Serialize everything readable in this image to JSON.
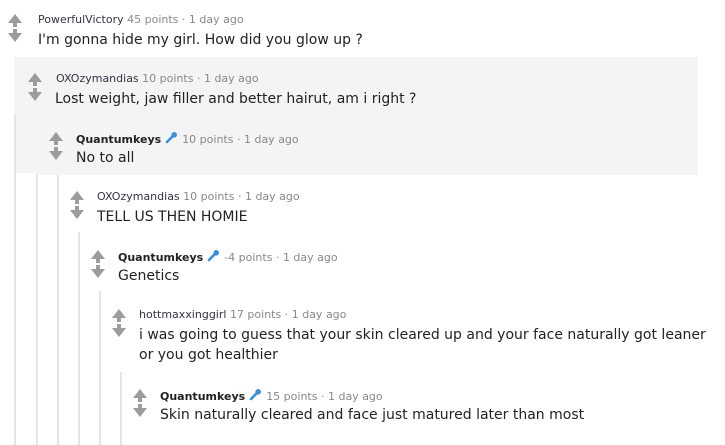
{
  "comments": [
    {
      "author": "PowerfulVictory",
      "points": "45 points",
      "sep": "·",
      "time": "1 day ago",
      "body": "I'm gonna hide my girl. How did you glow up ?"
    },
    {
      "author": "OXOzymandias",
      "points": "10 points",
      "sep": "·",
      "time": "1 day ago",
      "body": "Lost weight, jaw filler and better hairut, am i right ?"
    },
    {
      "author": "Quantumkeys",
      "points": "10 points",
      "sep": "·",
      "time": "1 day ago",
      "body": "No to all",
      "flair_icon": "microphone-icon"
    },
    {
      "author": "OXOzymandias",
      "points": "10 points",
      "sep": "·",
      "time": "1 day ago",
      "body": "TELL US THEN HOMIE"
    },
    {
      "author": "Quantumkeys",
      "points": "-4 points",
      "sep": "·",
      "time": "1 day ago",
      "body": "Genetics",
      "flair_icon": "microphone-icon"
    },
    {
      "author": "hottmaxxinggirl",
      "points": "17 points",
      "sep": "·",
      "time": "1 day ago",
      "body_line1": "i was going to guess that your skin cleared up and your face naturally got leaner",
      "body_line2": "or you got healthier"
    },
    {
      "author": "Quantumkeys",
      "points": "15 points",
      "sep": "·",
      "time": "1 day ago",
      "body": "Skin naturally cleared and face just matured later than most",
      "flair_icon": "microphone-icon"
    }
  ],
  "colors": {
    "background": "#ffffff",
    "nested_band": "#f4f4f4",
    "thread_bar": "#e5e5e5",
    "vote_arrow": "#9c9c9c",
    "meta_text": "#888888",
    "flair_mic": "#3a8fd6"
  }
}
